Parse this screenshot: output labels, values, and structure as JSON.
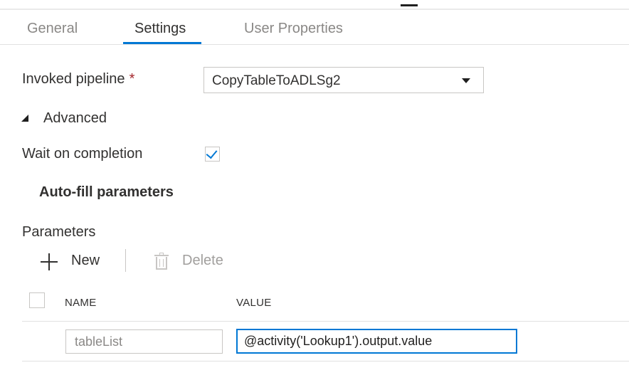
{
  "tabs": [
    {
      "label": "General",
      "active": false
    },
    {
      "label": "Settings",
      "active": true
    },
    {
      "label": "User Properties",
      "active": false
    }
  ],
  "invoked_pipeline": {
    "label": "Invoked pipeline",
    "required_marker": "*",
    "selected_value": "CopyTableToADLSg2"
  },
  "advanced": {
    "label": "Advanced",
    "expanded": true
  },
  "wait_on_completion": {
    "label": "Wait on completion",
    "checked": true
  },
  "autofill": {
    "label": "Auto-fill parameters"
  },
  "parameters": {
    "label": "Parameters",
    "new_label": "New",
    "delete_label": "Delete",
    "columns": [
      "NAME",
      "VALUE"
    ],
    "rows": [
      {
        "name": "tableList",
        "value": "@activity('Lookup1').output.value"
      }
    ]
  },
  "colors": {
    "accent": "#0078d4",
    "required": "#a4262c",
    "disabled_text": "#a19f9d"
  },
  "icons": [
    "caret-down-icon",
    "expand-triangle-icon",
    "checkmark-icon",
    "plus-icon",
    "trash-icon"
  ]
}
